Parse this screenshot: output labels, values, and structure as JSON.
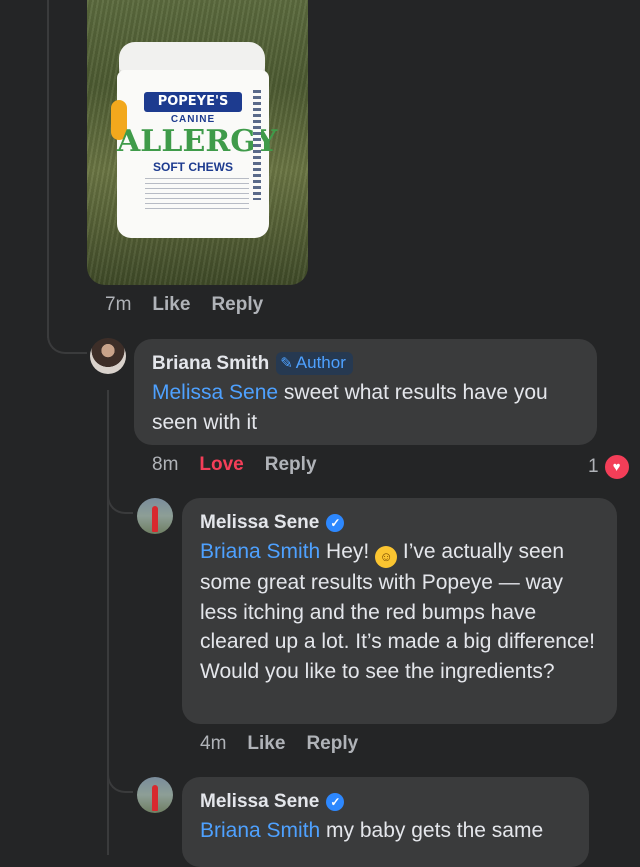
{
  "post_image": {
    "alt": "Popeye's Canine Allergy Soft Chews jar on grass",
    "product_brand": "POPEYE'S",
    "product_line1": "CANINE",
    "product_name": "ALLERGY",
    "product_line2": "SOFT CHEWS"
  },
  "comment_0_meta": {
    "time": "7m",
    "like": "Like",
    "reply": "Reply"
  },
  "comments": [
    {
      "author": "Briana Smith",
      "badge": "Author",
      "mention": "Melissa Sene",
      "text": " sweet what results have you seen with it",
      "time": "8m",
      "reaction_label": "Love",
      "reply": "Reply",
      "reaction_count": "1"
    },
    {
      "author": "Melissa Sene",
      "mention": "Briana Smith",
      "text_before_emoji": " Hey! ",
      "emoji": "smiling-face",
      "text_after_emoji": " I’ve actually seen some great results with Popeye — way less itching and the red bumps have cleared up a lot. It’s made a big difference! Would you like to see the ingredients?",
      "time": "4m",
      "like": "Like",
      "reply": "Reply"
    },
    {
      "author": "Melissa Sene",
      "mention": "Briana Smith",
      "text": " my baby gets the same"
    }
  ],
  "colors": {
    "background": "#242526",
    "bubble": "#3a3b3c",
    "mention": "#4ea1ff",
    "love": "#f33e58",
    "verified": "#2d88ff"
  }
}
